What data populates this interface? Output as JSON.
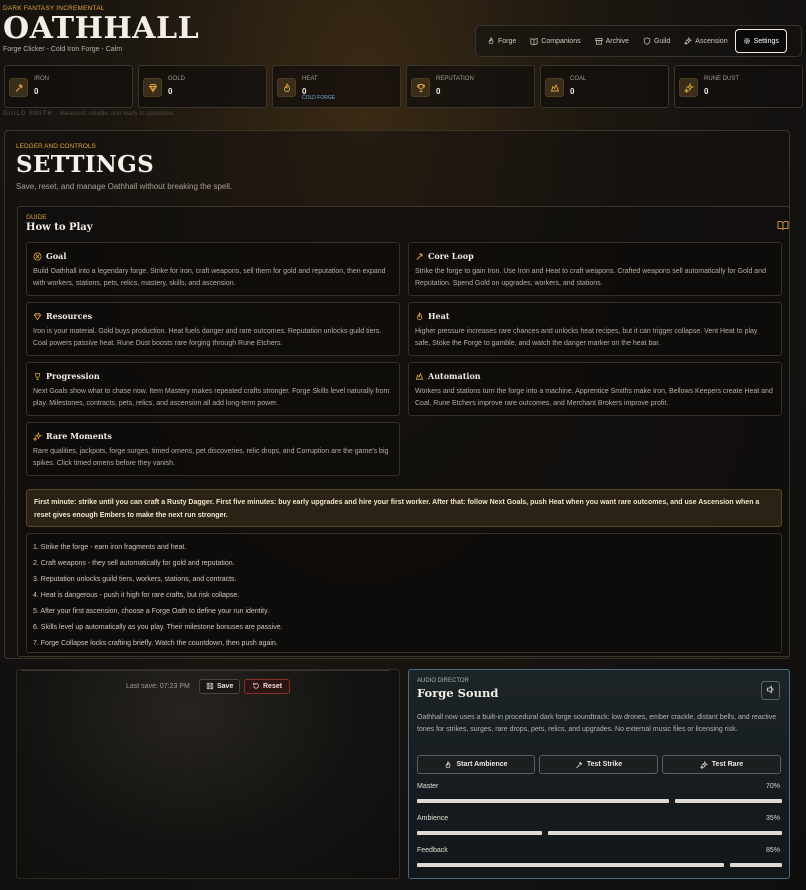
{
  "header": {
    "kicker": "DARK FANTASY INCREMENTAL",
    "title": "OATHHALL",
    "subtitle": "Forge Clicker - Cold Iron Forge - Calm"
  },
  "nav": {
    "items": [
      {
        "label": "Forge",
        "icon": "flame-icon"
      },
      {
        "label": "Companions",
        "icon": "book-icon"
      },
      {
        "label": "Archive",
        "icon": "chest-icon"
      },
      {
        "label": "Guild",
        "icon": "shield-icon"
      },
      {
        "label": "Ascension",
        "icon": "sparkle-icon"
      },
      {
        "label": "Settings",
        "icon": "gear-icon",
        "active": true
      }
    ]
  },
  "resources": [
    {
      "label": "IRON",
      "value": "0",
      "icon": "hammer-icon"
    },
    {
      "label": "GOLD",
      "value": "0",
      "icon": "gem-icon"
    },
    {
      "label": "HEAT",
      "value": "0",
      "note": "COLD FORGE",
      "icon": "flame-icon"
    },
    {
      "label": "REPUTATION",
      "value": "0",
      "icon": "trophy-icon"
    },
    {
      "label": "COAL",
      "value": "0",
      "icon": "coal-icon"
    },
    {
      "label": "RUNE DUST",
      "value": "0",
      "icon": "sparkle-icon"
    }
  ],
  "guild_line": {
    "rank": "GUILD SMITH",
    "separator": "·",
    "desc": "Balanced, reliable, and ready to specialize."
  },
  "settings": {
    "kicker": "LEDGER AND CONTROLS",
    "title": "SETTINGS",
    "subtitle": "Save, reset, and manage Oathhall without breaking the spell."
  },
  "guide": {
    "kicker": "GUIDE",
    "title": "How to Play",
    "cards": [
      {
        "title": "Goal",
        "icon": "target-icon",
        "body": "Build Oathhall into a legendary forge. Strike for iron, craft weapons, sell them for gold and reputation, then expand with workers, stations, pets, relics, mastery, skills, and ascension."
      },
      {
        "title": "Core Loop",
        "icon": "hammer-icon",
        "body": "Strike the forge to gain Iron. Use Iron and Heat to craft weapons. Crafted weapons sell automatically for Gold and Reputation. Spend Gold on upgrades, workers, and stations."
      },
      {
        "title": "Resources",
        "icon": "gem-icon",
        "body": "Iron is your material. Gold buys production. Heat fuels danger and rare outcomes. Reputation unlocks guild tiers. Coal powers passive heat. Rune Dust boosts rare forging through Rune Etchers."
      },
      {
        "title": "Heat",
        "icon": "flame-icon",
        "body": "Higher pressure increases rare chances and unlocks heat recipes, but it can trigger collapse. Vent Heat to play safe, Stoke the Forge to gamble, and watch the danger marker on the heat bar."
      },
      {
        "title": "Progression",
        "icon": "trophy-icon",
        "body": "Next Goals show what to chase now. Item Mastery makes repeated crafts stronger. Forge Skills level naturally from play. Milestones, contracts, pets, relics, and ascension all add long-term power."
      },
      {
        "title": "Automation",
        "icon": "coal-icon",
        "body": "Workers and stations turn the forge into a machine. Apprentice Smiths make Iron, Bellows Keepers create Heat and Coal, Rune Etchers improve rare outcomes, and Merchant Brokers improve profit."
      },
      {
        "title": "Rare Moments",
        "icon": "sparkle-icon",
        "body": "Rare qualities, jackpots, forge surges, timed omens, pet discoveries, relic drops, and Corruption are the game's big spikes. Click timed omens before they vanish."
      }
    ],
    "first_minute": "First minute: strike until you can craft a Rusty Dagger. First five minutes: buy early upgrades and hire your first worker. After that: follow Next Goals, push Heat when you want rare outcomes, and use Ascension when a reset gives enough Embers to make the next run stronger.",
    "steps": [
      "1. Strike the forge - earn iron fragments and heat.",
      "2. Craft weapons - they sell automatically for gold and reputation.",
      "3. Reputation unlocks guild tiers, workers, stations, and contracts.",
      "4. Heat is dangerous - push it high for rare crafts, but risk collapse.",
      "5. After your first ascension, choose a Forge Oath to define your run identity.",
      "6. Skills level up automatically as you play. Their milestone bonuses are passive.",
      "7. Forge Collapse locks crafting briefly. Watch the countdown, then push again."
    ]
  },
  "save": {
    "last_save": "Last save: 07:23 PM",
    "save_label": "Save",
    "reset_label": "Reset"
  },
  "audio": {
    "kicker": "AUDIO DIRECTOR",
    "title": "Forge Sound",
    "desc": "Oathhall now uses a built-in procedural dark forge soundtrack: low drones, ember crackle, distant bells, and reactive tones for strikes, surges, rare drops, pets, relics, and upgrades. No external music files or licensing risk.",
    "buttons": [
      {
        "label": "Start Ambience",
        "icon": "flame-icon"
      },
      {
        "label": "Test Strike",
        "icon": "hammer-icon"
      },
      {
        "label": "Test Rare",
        "icon": "sparkle-icon"
      }
    ],
    "sliders": [
      {
        "label": "Master",
        "value_text": "70%",
        "value": 0.7
      },
      {
        "label": "Ambience",
        "value_text": "35%",
        "value": 0.35
      },
      {
        "label": "Feedback",
        "value_text": "85%",
        "value": 0.85
      }
    ]
  },
  "colors": {
    "accent": "#e0a53c",
    "panel_border": "#3a342b",
    "audio_border": "#4a6d82",
    "reset_border": "#8b2f28",
    "heat_note": "#6db4d8"
  }
}
